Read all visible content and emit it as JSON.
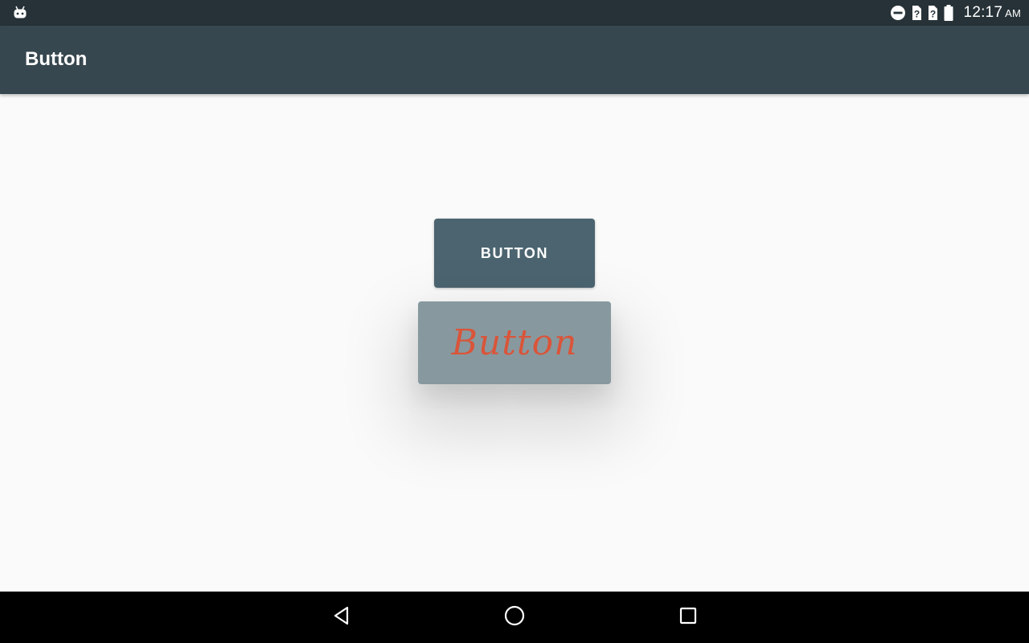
{
  "status_bar": {
    "time": "12:17",
    "ampm": "AM",
    "icons": [
      "android-icon",
      "do-not-disturb-icon",
      "unknown-sim-icon",
      "unknown-sim-icon",
      "battery-icon"
    ]
  },
  "app_bar": {
    "title": "Button"
  },
  "content": {
    "primary_button_label": "BUTTON",
    "styled_button_label": "Button"
  },
  "nav_bar": {
    "icons": [
      "back-icon",
      "home-icon",
      "recents-icon"
    ]
  },
  "colors": {
    "status_bar": "#263238",
    "app_bar": "#37474f",
    "primary_button": "#4b6470",
    "styled_button": "#87999f",
    "styled_button_text": "#d9553a",
    "background": "#fafafa"
  }
}
